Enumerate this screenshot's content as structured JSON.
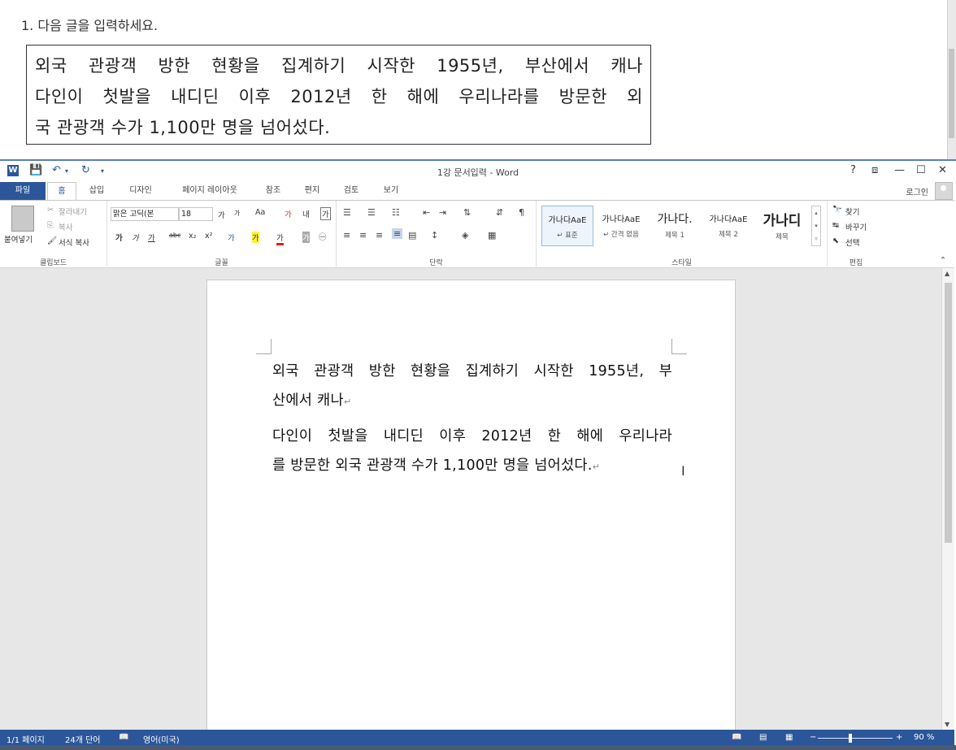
{
  "instruction": "1. 다음 글을 입력하세요.",
  "passage_lines": [
    "외국 관광객 방한 현황을 집계하기 시작한 1955년, 부산에서 캐나",
    "다인이 첫발을 내디딘 이후 2012년 한 해에 우리나라를 방문한 외",
    "국 관광객 수가 1,100만 명을 넘어섰다."
  ],
  "word": {
    "title": "1강 문서입력 - Word",
    "file_tab": "파일",
    "tabs": [
      "홈",
      "삽입",
      "디자인",
      "페이지 레이아웃",
      "참조",
      "편지",
      "검토",
      "보기"
    ],
    "login": "로그인",
    "window_buttons": {
      "help": "?",
      "ribbon_display": "⧈",
      "minimize": "—",
      "maximize": "☐",
      "close": "✕"
    },
    "clipboard": {
      "paste": "붙여넣기",
      "cut": "잘라내기",
      "copy": "복사",
      "format_painter": "서식 복사",
      "label": "클립보드"
    },
    "font": {
      "name": "맑은 고딕(본",
      "size": "18",
      "grow": "가",
      "shrink": "가",
      "case": "Aa",
      "clear": "가",
      "phonetic": "내",
      "border_char": "가",
      "bold": "가",
      "italic": "가",
      "underline": "가",
      "strike": "abc",
      "sub": "x₂",
      "sup": "x²",
      "effects": "가",
      "highlight": "가",
      "color": "가",
      "shade": "가",
      "enclose": "㊀",
      "label": "글꼴"
    },
    "paragraph": {
      "label": "단락"
    },
    "styles": {
      "items": [
        {
          "sample": "가나다AaE",
          "name": "↵ 표준"
        },
        {
          "sample": "가나다AaE",
          "name": "↵ 간격 없음"
        },
        {
          "sample": "가나다.",
          "name": "제목 1"
        },
        {
          "sample": "가나다AaE",
          "name": "제목 2"
        },
        {
          "sample": "가나디",
          "name": "제목"
        }
      ],
      "label": "스타일"
    },
    "editing": {
      "find": "찾기",
      "replace": "바꾸기",
      "select": "선택",
      "label": "편집"
    },
    "document_lines": [
      {
        "text": "외국 관광객 방한 현황을 집계하기 시작한 1955년, 부",
        "mark": ""
      },
      {
        "text": "산에서 캐나",
        "mark": "↵"
      },
      {
        "text": "다인이 첫발을 내디딘 이후 2012년 한 해에 우리나라",
        "mark": ""
      },
      {
        "text": "를 방문한 외국 관광객 수가 1,100만 명을 넘어섰다.",
        "mark": "↵"
      }
    ],
    "status": {
      "page": "1/1 페이지",
      "words": "24개 단어",
      "language": "영어(미국)",
      "zoom": "90 %",
      "zoom_minus": "−",
      "zoom_plus": "+"
    },
    "colors": {
      "accent": "#2b579a",
      "status_bar": "#2b579a"
    }
  }
}
